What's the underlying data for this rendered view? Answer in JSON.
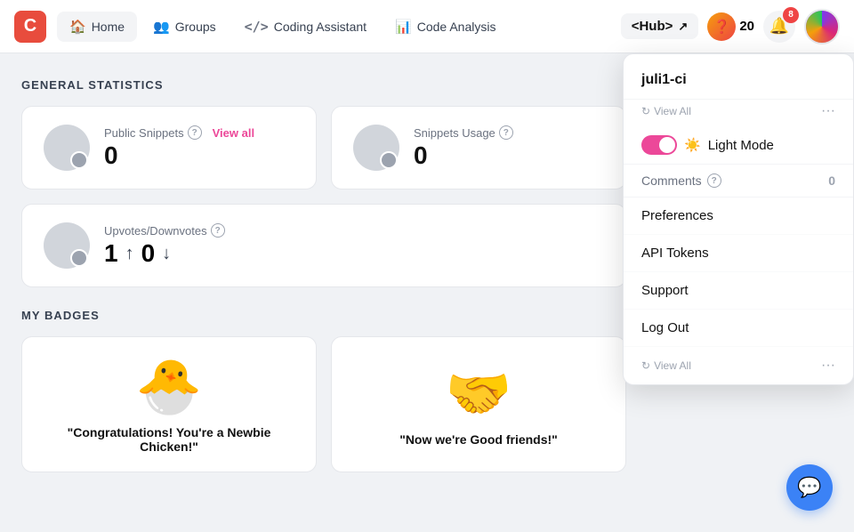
{
  "header": {
    "logo_letter": "C",
    "nav_items": [
      {
        "id": "home",
        "label": "Home",
        "icon": "🏠",
        "active": true
      },
      {
        "id": "groups",
        "label": "Groups",
        "icon": "👥"
      },
      {
        "id": "coding-assistant",
        "label": "Coding Assistant",
        "icon": "</>"
      },
      {
        "id": "code-analysis",
        "label": "Code Analysis",
        "icon": "📊"
      }
    ],
    "hub_label": "<Hub>",
    "hub_icon": "🔗",
    "points": 20,
    "notification_count": 8,
    "bell_icon": "🔔"
  },
  "main": {
    "general_statistics_title": "GENERAL STATISTICS",
    "stats": [
      {
        "id": "public-snippets",
        "label": "Public Snippets",
        "value": "0",
        "has_help": true,
        "has_view_all": true,
        "view_all_label": "View all"
      },
      {
        "id": "snippets-usage",
        "label": "Snippets Usage",
        "value": "0",
        "has_help": true,
        "has_view_all": false
      }
    ],
    "upvotes": {
      "label": "Upvotes/Downvotes",
      "up_value": "1",
      "down_value": "0",
      "has_help": true
    },
    "my_badges_title": "MY BADGES",
    "badges": [
      {
        "id": "newbie-chicken",
        "emoji": "🐣",
        "title": "\"Congratulations! You're a Newbie Chicken!\""
      },
      {
        "id": "good-friends",
        "emoji": "🤝",
        "title": "\"Now we're Good friends!\""
      }
    ]
  },
  "dropdown": {
    "username": "juli1-ci",
    "view_all_label": "View All",
    "light_mode_label": "Light Mode",
    "light_mode_emoji": "☀️",
    "light_mode_active": true,
    "comments_label": "Comments",
    "comments_count": "0",
    "preferences_label": "Preferences",
    "api_tokens_label": "API Tokens",
    "support_label": "Support",
    "logout_label": "Log Out",
    "footer_view_all": "View All"
  },
  "chat_icon": "💬"
}
